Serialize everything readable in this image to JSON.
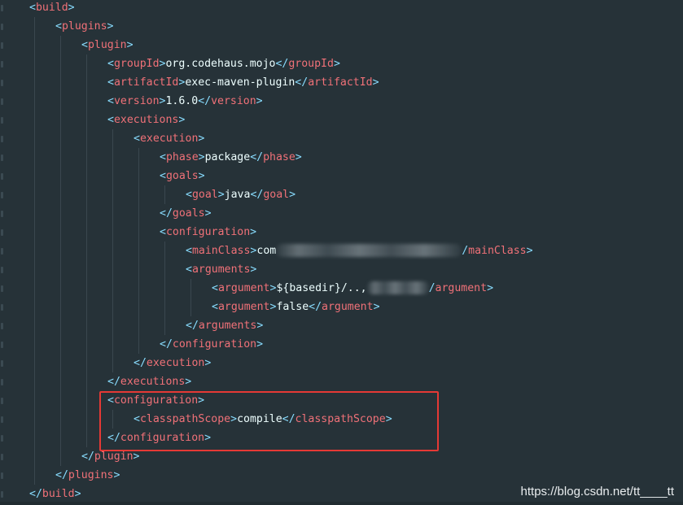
{
  "code_lines": [
    {
      "indent": 1,
      "parts": [
        [
          "punc",
          "<"
        ],
        [
          "tag",
          "build"
        ],
        [
          "punc",
          ">"
        ]
      ]
    },
    {
      "indent": 2,
      "parts": [
        [
          "punc",
          "<"
        ],
        [
          "tag",
          "plugins"
        ],
        [
          "punc",
          ">"
        ]
      ]
    },
    {
      "indent": 3,
      "parts": [
        [
          "punc",
          "<"
        ],
        [
          "tag",
          "plugin"
        ],
        [
          "punc",
          ">"
        ]
      ]
    },
    {
      "indent": 4,
      "parts": [
        [
          "punc",
          "<"
        ],
        [
          "tag",
          "groupId"
        ],
        [
          "punc",
          ">"
        ],
        [
          "txt",
          "org.codehaus.mojo"
        ],
        [
          "punc",
          "</"
        ],
        [
          "tag",
          "groupId"
        ],
        [
          "punc",
          ">"
        ]
      ]
    },
    {
      "indent": 4,
      "parts": [
        [
          "punc",
          "<"
        ],
        [
          "tag",
          "artifactId"
        ],
        [
          "punc",
          ">"
        ],
        [
          "txt",
          "exec-maven-plugin"
        ],
        [
          "punc",
          "</"
        ],
        [
          "tag",
          "artifactId"
        ],
        [
          "punc",
          ">"
        ]
      ]
    },
    {
      "indent": 4,
      "parts": [
        [
          "punc",
          "<"
        ],
        [
          "tag",
          "version"
        ],
        [
          "punc",
          ">"
        ],
        [
          "txt",
          "1.6.0"
        ],
        [
          "punc",
          "</"
        ],
        [
          "tag",
          "version"
        ],
        [
          "punc",
          ">"
        ]
      ]
    },
    {
      "indent": 4,
      "parts": [
        [
          "punc",
          "<"
        ],
        [
          "tag",
          "executions"
        ],
        [
          "punc",
          ">"
        ]
      ]
    },
    {
      "indent": 5,
      "parts": [
        [
          "punc",
          "<"
        ],
        [
          "tag",
          "execution"
        ],
        [
          "punc",
          ">"
        ]
      ]
    },
    {
      "indent": 6,
      "parts": [
        [
          "punc",
          "<"
        ],
        [
          "tag",
          "phase"
        ],
        [
          "punc",
          ">"
        ],
        [
          "txt",
          "package"
        ],
        [
          "punc",
          "</"
        ],
        [
          "tag",
          "phase"
        ],
        [
          "punc",
          ">"
        ]
      ]
    },
    {
      "indent": 6,
      "parts": [
        [
          "punc",
          "<"
        ],
        [
          "tag",
          "goals"
        ],
        [
          "punc",
          ">"
        ]
      ]
    },
    {
      "indent": 7,
      "parts": [
        [
          "punc",
          "<"
        ],
        [
          "tag",
          "goal"
        ],
        [
          "punc",
          ">"
        ],
        [
          "txt",
          "java"
        ],
        [
          "punc",
          "</"
        ],
        [
          "tag",
          "goal"
        ],
        [
          "punc",
          ">"
        ]
      ]
    },
    {
      "indent": 6,
      "parts": [
        [
          "punc",
          "</"
        ],
        [
          "tag",
          "goals"
        ],
        [
          "punc",
          ">"
        ]
      ]
    },
    {
      "indent": 6,
      "parts": [
        [
          "punc",
          "<"
        ],
        [
          "tag",
          "configuration"
        ],
        [
          "punc",
          ">"
        ]
      ]
    },
    {
      "indent": 7,
      "parts": [
        [
          "punc",
          "<"
        ],
        [
          "tag",
          "mainClass"
        ],
        [
          "punc",
          ">"
        ],
        [
          "txt",
          "com"
        ],
        [
          "blur",
          "228"
        ],
        [
          "punc",
          "/"
        ],
        [
          "tag",
          "mainClass"
        ],
        [
          "punc",
          ">"
        ]
      ]
    },
    {
      "indent": 7,
      "parts": [
        [
          "punc",
          "<"
        ],
        [
          "tag",
          "arguments"
        ],
        [
          "punc",
          ">"
        ]
      ]
    },
    {
      "indent": 8,
      "parts": [
        [
          "punc",
          "<"
        ],
        [
          "tag",
          "argument"
        ],
        [
          "punc",
          ">"
        ],
        [
          "txt",
          "${basedir}/..,"
        ],
        [
          "blur",
          "76"
        ],
        [
          "punc",
          "/"
        ],
        [
          "tag",
          "argument"
        ],
        [
          "punc",
          ">"
        ]
      ]
    },
    {
      "indent": 8,
      "parts": [
        [
          "punc",
          "<"
        ],
        [
          "tag",
          "argument"
        ],
        [
          "punc",
          ">"
        ],
        [
          "txt",
          "false"
        ],
        [
          "punc",
          "</"
        ],
        [
          "tag",
          "argument"
        ],
        [
          "punc",
          ">"
        ]
      ]
    },
    {
      "indent": 7,
      "parts": [
        [
          "punc",
          "</"
        ],
        [
          "tag",
          "arguments"
        ],
        [
          "punc",
          ">"
        ]
      ]
    },
    {
      "indent": 6,
      "parts": [
        [
          "punc",
          "</"
        ],
        [
          "tag",
          "configuration"
        ],
        [
          "punc",
          ">"
        ]
      ]
    },
    {
      "indent": 5,
      "parts": [
        [
          "punc",
          "</"
        ],
        [
          "tag",
          "execution"
        ],
        [
          "punc",
          ">"
        ]
      ]
    },
    {
      "indent": 4,
      "parts": [
        [
          "punc",
          "</"
        ],
        [
          "tag",
          "executions"
        ],
        [
          "punc",
          ">"
        ]
      ]
    },
    {
      "indent": 4,
      "parts": [
        [
          "punc",
          "<"
        ],
        [
          "tag",
          "configuration"
        ],
        [
          "punc",
          ">"
        ]
      ]
    },
    {
      "indent": 5,
      "parts": [
        [
          "punc",
          "<"
        ],
        [
          "tag",
          "classpathScope"
        ],
        [
          "punc",
          ">"
        ],
        [
          "txt",
          "compile"
        ],
        [
          "punc",
          "</"
        ],
        [
          "tag",
          "classpathScope"
        ],
        [
          "punc",
          ">"
        ]
      ]
    },
    {
      "indent": 4,
      "parts": [
        [
          "punc",
          "</"
        ],
        [
          "tag",
          "configuration"
        ],
        [
          "punc",
          ">"
        ]
      ]
    },
    {
      "indent": 3,
      "parts": [
        [
          "punc",
          "</"
        ],
        [
          "tag",
          "plugin"
        ],
        [
          "punc",
          ">"
        ]
      ]
    },
    {
      "indent": 2,
      "parts": [
        [
          "punc",
          "</"
        ],
        [
          "tag",
          "plugins"
        ],
        [
          "punc",
          ">"
        ]
      ]
    },
    {
      "indent": 1,
      "parts": [
        [
          "punc",
          "</"
        ],
        [
          "tag",
          "build"
        ],
        [
          "punc",
          ">"
        ]
      ]
    }
  ],
  "highlight": {
    "color": "#e53935",
    "first_line": 21,
    "last_line": 23
  },
  "watermark": "https://blog.csdn.net/tt____tt",
  "colors": {
    "background": "#263238",
    "tag": "#F07178",
    "punctuation": "#89DDFF",
    "text": "#EEFFFF"
  }
}
